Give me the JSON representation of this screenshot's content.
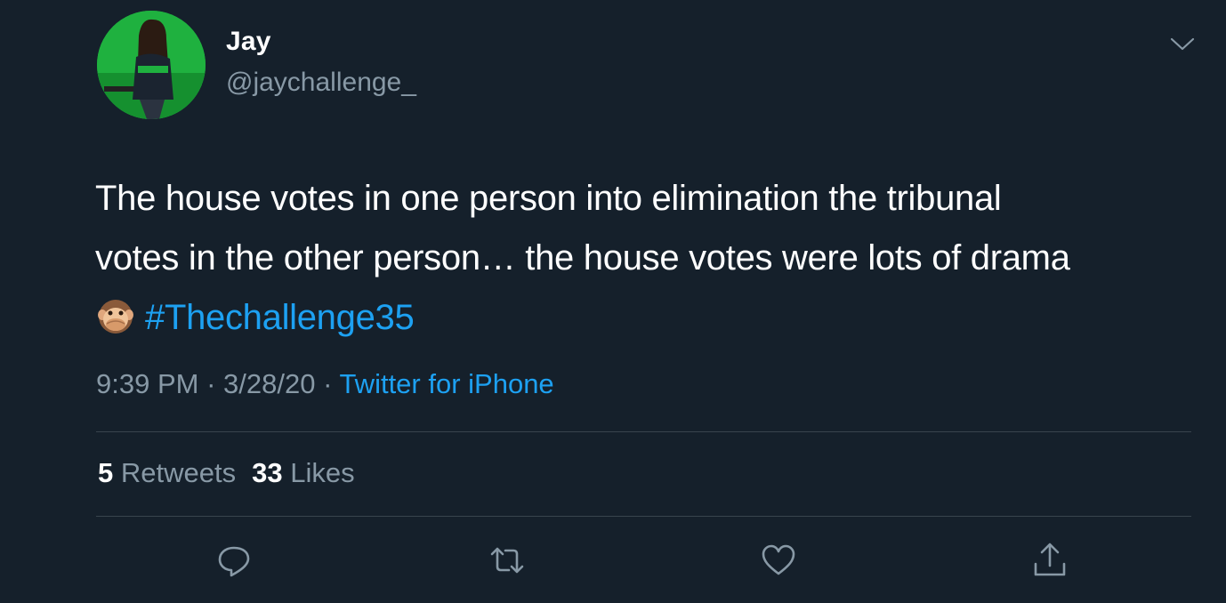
{
  "user": {
    "display_name": "Jay",
    "handle": "@jaychallenge_",
    "avatar_icon": "profile-photo"
  },
  "tweet": {
    "line1": "The house votes in one person into elimination the tribunal",
    "line2": "votes in the other person… the house votes were lots of drama",
    "emoji": "🙊",
    "hashtag": "#Thechallenge35"
  },
  "meta": {
    "time": "9:39 PM",
    "sep1": " · ",
    "date": "3/28/20",
    "sep2": " · ",
    "source": "Twitter for iPhone"
  },
  "stats": {
    "retweets_count": "5",
    "retweets_label": "Retweets",
    "likes_count": "33",
    "likes_label": "Likes"
  },
  "actions": [
    {
      "icon": "reply-icon"
    },
    {
      "icon": "retweet-icon"
    },
    {
      "icon": "like-icon"
    },
    {
      "icon": "share-icon"
    }
  ],
  "colors": {
    "background": "#15202b",
    "text": "#ffffff",
    "secondary": "#8899a6",
    "accent": "#1da1f2",
    "divider": "#38444d"
  }
}
